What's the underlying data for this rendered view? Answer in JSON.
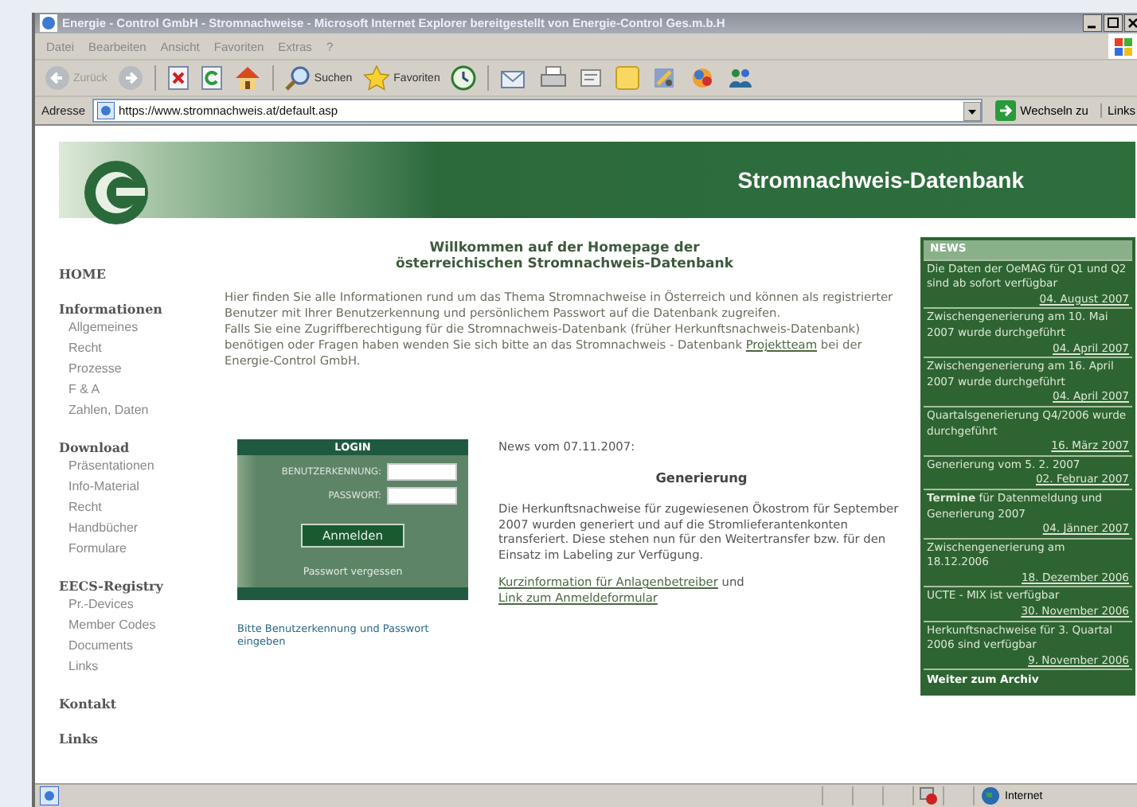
{
  "window": {
    "title": "Energie - Control GmbH - Stromnachweise - Microsoft Internet Explorer bereitgestellt von Energie-Control Ges.m.b.H"
  },
  "menu": [
    "Datei",
    "Bearbeiten",
    "Ansicht",
    "Favoriten",
    "Extras",
    "?"
  ],
  "toolbar": [
    {
      "kind": "back",
      "label": "Zurück"
    },
    {
      "kind": "forward"
    },
    {
      "kind": "stop"
    },
    {
      "kind": "refresh"
    },
    {
      "kind": "home"
    },
    {
      "kind": "search",
      "label": "Suchen"
    },
    {
      "kind": "favorites",
      "label": "Favoriten"
    },
    {
      "kind": "history"
    },
    {
      "kind": "mail"
    },
    {
      "kind": "print"
    },
    {
      "kind": "edit"
    },
    {
      "kind": "note"
    },
    {
      "kind": "tools"
    },
    {
      "kind": "messenger"
    },
    {
      "kind": "people"
    }
  ],
  "address": {
    "label": "Adresse",
    "url": "https://www.stromnachweis.at/default.asp",
    "go": "Wechseln zu",
    "links": "Links"
  },
  "banner": {
    "title": "Stromnachweis-Datenbank"
  },
  "nav": [
    {
      "label": "HOME"
    },
    {
      "label": "Informationen",
      "children": [
        {
          "label": "Allgemeines"
        },
        {
          "label": "Recht"
        },
        {
          "label": "Prozesse"
        },
        {
          "label": "F & A"
        },
        {
          "label": "Zahlen, Daten"
        }
      ]
    },
    {
      "label": "Download",
      "children": [
        {
          "label": "Präsentationen"
        },
        {
          "label": "Info-Material"
        },
        {
          "label": "Recht"
        },
        {
          "label": "Handbücher"
        },
        {
          "label": "Formulare"
        }
      ]
    },
    {
      "label": "EECS-Registry",
      "children": [
        {
          "label": "Pr.-Devices"
        },
        {
          "label": "Member Codes"
        },
        {
          "label": "Documents"
        },
        {
          "label": "Links"
        }
      ]
    },
    {
      "label": "Kontakt"
    },
    {
      "label": "Links"
    }
  ],
  "welcome": {
    "heading": [
      "Willkommen auf der Homepage der",
      "österreichischen Stromnachweis-Datenbank"
    ],
    "paragraphs": [
      [
        {
          "kind": "text",
          "text": "Hier finden Sie alle Informationen rund um das Thema Stromnachweise in Österreich und können als registrierter Benutzer mit Ihrer Benutzerkennung und persönlichem Passwort auf die Datenbank zugreifen."
        }
      ],
      [
        {
          "kind": "text",
          "text": "Falls Sie eine Zugriffberechtigung für die Stromnachweis-Datenbank (früher Herkunftsnachweis-Datenbank) benötigen oder Fragen haben wenden Sie sich bitte an das Stromnachweis - Datenbank "
        },
        {
          "kind": "link",
          "text": "Projektteam"
        },
        {
          "kind": "text",
          "text": " bei der Energie-Control GmbH."
        }
      ]
    ]
  },
  "login": {
    "title": "LOGIN",
    "fields": [
      {
        "label": "BENUTZERKENNUNG:"
      },
      {
        "label": "PASSWORT:"
      }
    ],
    "button": "Anmelden",
    "forgot": "Passwort vergessen",
    "hint": "Bitte Benutzerkennung und Passwort eingeben"
  },
  "news": {
    "date_line": "News vom 07.11.2007:",
    "heading": "Generierung",
    "body": "Die Herkunftsnachweise für zugewiesenen Ökostrom für September 2007 wurden generiert und auf die Stromlieferantenkonten transferiert. Diese stehen nun für den Weitertransfer bzw. für den Einsatz im Labeling zur Verfügung.",
    "links": [
      {
        "kind": "link",
        "text": "Kurzinformation für Anlagenbetreiber"
      },
      {
        "kind": "text",
        "text": " und "
      },
      {
        "kind": "link",
        "text": "Link zum Anmeldeformular"
      }
    ]
  },
  "sidebar_news": {
    "title": "NEWS",
    "items": [
      {
        "text": "Die Daten der OeMAG für Q1 und Q2 sind ab sofort verfügbar",
        "date": "04. August 2007"
      },
      {
        "text": "Zwischengenerierung am 10. Mai 2007 wurde durchgeführt",
        "date": "04. April 2007"
      },
      {
        "text": "Zwischengenerierung am 16. April 2007 wurde durchgeführt",
        "date": "04. April 2007"
      },
      {
        "text": "Quartalsgenerierung Q4/2006 wurde durchgeführt",
        "date": "16. März 2007"
      },
      {
        "text": "Generierung vom 5. 2. 2007",
        "date": "02. Februar 2007"
      },
      {
        "text": "**Termine** für Datenmeldung und Generierung 2007",
        "date": "04. Jänner 2007"
      },
      {
        "text": "Zwischengenerierung am 18.12.2006",
        "date": "18. Dezember 2006"
      },
      {
        "text": "UCTE - MIX ist verfügbar",
        "date": "30. November 2006"
      },
      {
        "text": "Herkunftsnachweise für 3. Quartal 2006 sind verfügbar",
        "date": "9. November 2006"
      }
    ],
    "archive": "Weiter zum Archiv"
  },
  "status_bar": {
    "zone": "Internet"
  }
}
